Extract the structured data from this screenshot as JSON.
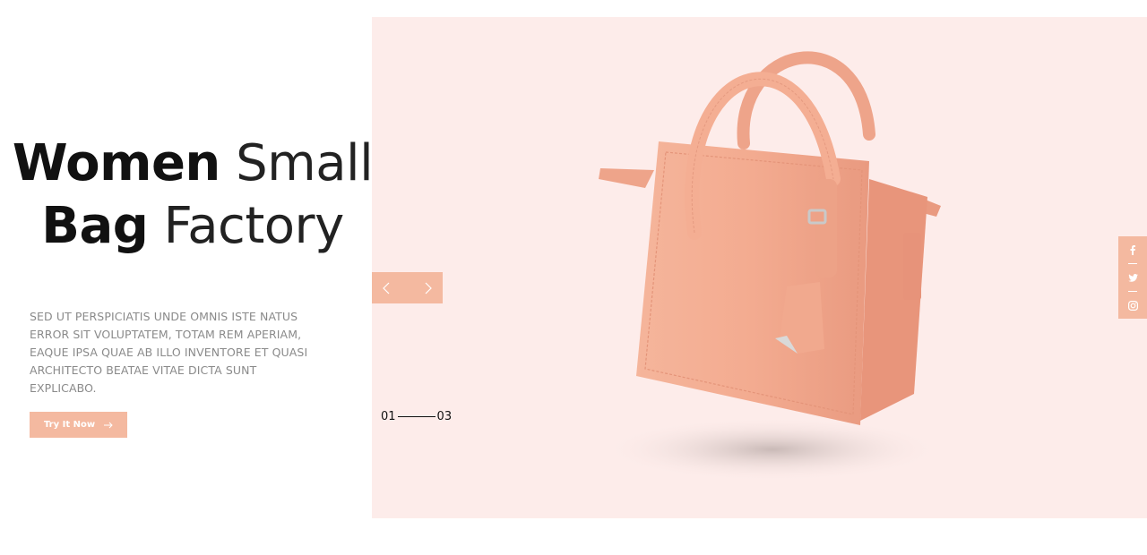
{
  "hero": {
    "title_line1_bold": "Women",
    "title_line1_light": "Small",
    "title_line2_bold": "Bag",
    "title_line2_light": "Factory",
    "description": "SED UT PERSPICIATIS UNDE OMNIS ISTE NATUS ERROR SIT VOLUPTATEM, TOTAM REM APERIAM, EAQUE IPSA QUAE AB ILLO INVENTORE ET QUASI ARCHITECTO BEATAE VITAE DICTA SUNT EXPLICABO.",
    "cta_label": "Try It Now",
    "cta_icon": "arrow-right-icon"
  },
  "slider": {
    "current": "01",
    "total": "03",
    "prev_icon": "chevron-left-icon",
    "next_icon": "chevron-right-icon"
  },
  "social": [
    "facebook-icon",
    "twitter-icon",
    "instagram-icon"
  ],
  "colors": {
    "accent": "#f4b9a0",
    "panel_bg": "#fdecea",
    "bag": "#f3ab90",
    "text": "#111111",
    "muted": "#8a8a8a"
  }
}
